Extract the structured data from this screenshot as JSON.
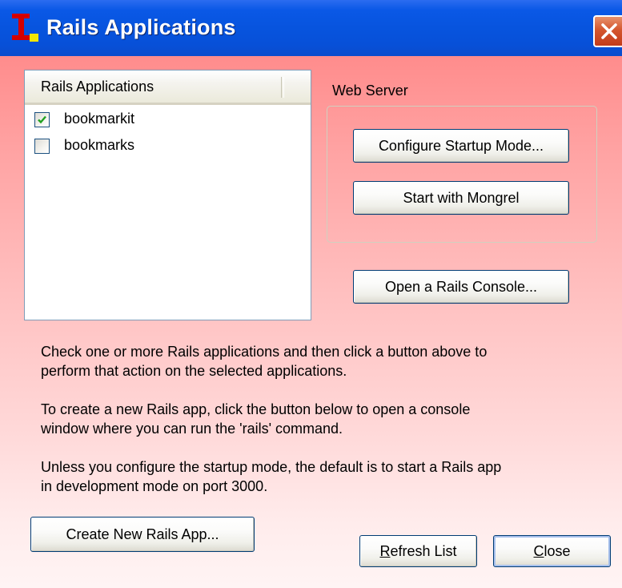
{
  "window": {
    "title": "Rails Applications"
  },
  "apps_list": {
    "header": "Rails Applications",
    "items": [
      {
        "label": "bookmarkit",
        "checked": true
      },
      {
        "label": "bookmarks",
        "checked": false
      }
    ]
  },
  "web_server": {
    "label": "Web Server",
    "configure_button": "Configure Startup Mode...",
    "mongrel_button": "Start with Mongrel"
  },
  "console_button": "Open a Rails Console...",
  "info": {
    "line1": "Check one or more Rails applications and then click a button above to",
    "line2": "perform that action on the selected applications.",
    "line3": "To create a new Rails app, click the button below to open a console",
    "line4": "window where you can run the 'rails' command.",
    "line5": "Unless you configure the startup mode, the default is to start a Rails app",
    "line6": "in development mode on port 3000."
  },
  "footer": {
    "create_button": "Create New Rails App...",
    "refresh_mnemonic": "R",
    "refresh_rest": "efresh List",
    "close_mnemonic": "C",
    "close_rest": "lose"
  },
  "icons": {
    "app_icon": "instantrails-icon",
    "close_icon": "close-x-icon",
    "check_icon": "checkmark-icon"
  },
  "colors": {
    "titlebar_blue": "#0754de",
    "body_pink_top": "#ff8c8c",
    "body_pink_bottom": "#fff4f4",
    "checkmark_green": "#21a121",
    "app_icon_red": "#d40000",
    "app_icon_yellow": "#f2e600"
  }
}
